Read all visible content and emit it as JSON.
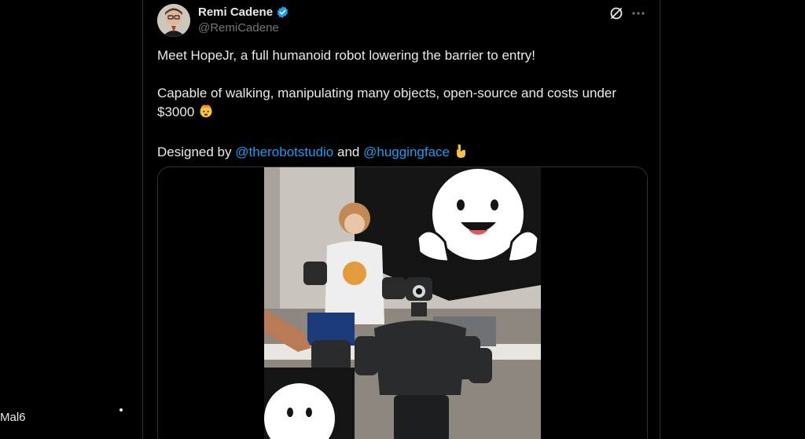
{
  "sidebar": {
    "label": "Mal6"
  },
  "tweet": {
    "author": {
      "display_name": "Remi Cadene",
      "handle": "@RemiCadene",
      "verified": true
    },
    "line1": "Meet HopeJr, a full humanoid robot lowering the barrier to entry!",
    "line2": "Capable of walking, manipulating many objects, open-source and costs under $3000",
    "line2_emoji": "exploding-head-emoji",
    "line3_prefix": "Designed by",
    "mention1": "@therobotstudio",
    "line3_and": "and",
    "mention2": "@huggingface",
    "line3_emoji": "pointing-down-emoji",
    "media": {
      "kind": "video",
      "subject": "humanoid-robot-photo"
    }
  },
  "icons": {
    "grok": "grok-icon",
    "more": "more-icon",
    "verified": "verified-badge-icon"
  },
  "colors": {
    "background": "#000000",
    "text": "#e7e9ea",
    "secondary": "#71767b",
    "link": "#1d9bf0",
    "border": "#2f3336"
  }
}
